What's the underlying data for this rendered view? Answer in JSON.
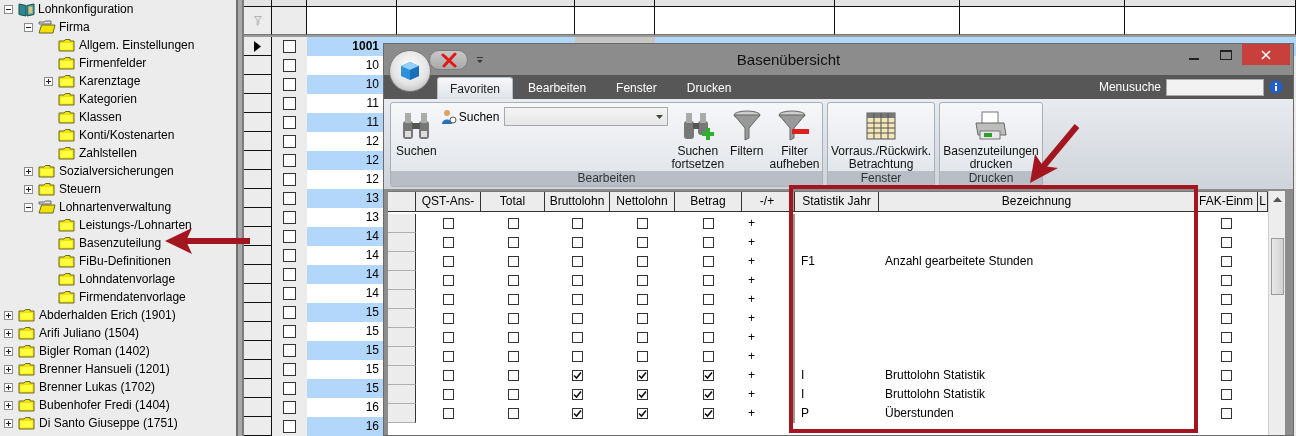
{
  "tree": [
    {
      "label": "Lohnkonfiguration",
      "kind": "root",
      "expanded": true,
      "children": [
        {
          "label": "Firma",
          "kind": "node",
          "expanded": true,
          "children": [
            {
              "label": "Allgem. Einstellungen",
              "kind": "leaf"
            },
            {
              "label": "Firmenfelder",
              "kind": "leaf"
            },
            {
              "label": "Karenztage",
              "kind": "node",
              "expanded": false
            },
            {
              "label": "Kategorien",
              "kind": "leaf"
            },
            {
              "label": "Klassen",
              "kind": "leaf"
            },
            {
              "label": "Konti/Kostenarten",
              "kind": "leaf"
            },
            {
              "label": "Zahlstellen",
              "kind": "leaf"
            }
          ]
        },
        {
          "label": "Sozialversicherungen",
          "kind": "node",
          "expanded": false
        },
        {
          "label": "Steuern",
          "kind": "node",
          "expanded": false
        },
        {
          "label": "Lohnartenverwaltung",
          "kind": "node",
          "expanded": true,
          "children": [
            {
              "label": "Leistungs-/Lohnarten",
              "kind": "leaf"
            },
            {
              "label": "Basenzuteilung",
              "kind": "leaf"
            },
            {
              "label": "FiBu-Definitionen",
              "kind": "leaf"
            },
            {
              "label": "Lohndatenvorlage",
              "kind": "leaf"
            },
            {
              "label": "Firmendatenvorlage",
              "kind": "leaf"
            }
          ]
        }
      ]
    },
    {
      "label": "Abderhalden Erich (1901)",
      "kind": "node",
      "expanded": false
    },
    {
      "label": "Arifi Juliano (1504)",
      "kind": "node",
      "expanded": false
    },
    {
      "label": "Bigler Roman (1402)",
      "kind": "node",
      "expanded": false
    },
    {
      "label": "Brenner Hansueli (1201)",
      "kind": "node",
      "expanded": false
    },
    {
      "label": "Brenner Lukas (1702)",
      "kind": "node",
      "expanded": false
    },
    {
      "label": "Bubenhofer Fredi (1404)",
      "kind": "node",
      "expanded": false
    },
    {
      "label": "Di Santo Giuseppe (1751)",
      "kind": "node",
      "expanded": false
    }
  ],
  "employee_table": {
    "rows": [
      {
        "selected": true,
        "checked": false,
        "cells": [
          "1001"
        ]
      },
      {
        "selected": false,
        "checked": false,
        "cells": [
          "10"
        ]
      },
      {
        "selected": false,
        "checked": false,
        "cells": [
          "10"
        ]
      },
      {
        "selected": false,
        "checked": false,
        "cells": [
          "11"
        ]
      },
      {
        "selected": false,
        "checked": false,
        "cells": [
          "11"
        ]
      },
      {
        "selected": false,
        "checked": false,
        "cells": [
          "12"
        ]
      },
      {
        "selected": false,
        "checked": false,
        "cells": [
          "12"
        ]
      },
      {
        "selected": false,
        "checked": false,
        "cells": [
          "12"
        ]
      },
      {
        "selected": false,
        "checked": false,
        "cells": [
          "13"
        ]
      },
      {
        "selected": false,
        "checked": false,
        "cells": [
          "13"
        ]
      },
      {
        "selected": false,
        "checked": false,
        "cells": [
          "14"
        ]
      },
      {
        "selected": false,
        "checked": false,
        "cells": [
          "14"
        ]
      },
      {
        "selected": false,
        "checked": false,
        "cells": [
          "14"
        ]
      },
      {
        "selected": false,
        "checked": false,
        "cells": [
          "14"
        ]
      },
      {
        "selected": false,
        "checked": false,
        "cells": [
          "15"
        ]
      },
      {
        "selected": false,
        "checked": false,
        "cells": [
          "15"
        ]
      },
      {
        "selected": false,
        "checked": false,
        "cells": [
          "15"
        ]
      },
      {
        "selected": false,
        "checked": false,
        "cells": [
          "15"
        ]
      },
      {
        "selected": false,
        "checked": false,
        "cells": [
          "15"
        ]
      },
      {
        "selected": false,
        "checked": false,
        "cells": [
          "16"
        ]
      },
      {
        "selected": false,
        "checked": false,
        "cells": [
          "16"
        ]
      }
    ]
  },
  "window": {
    "title": "Basenübersicht",
    "ribbon": {
      "tabs": [
        {
          "label": "Favoriten",
          "selected": true
        },
        {
          "label": "Bearbeiten",
          "selected": false
        },
        {
          "label": "Fenster",
          "selected": false
        },
        {
          "label": "Drucken",
          "selected": false
        }
      ],
      "menu_search": {
        "label": "Menusuche"
      },
      "groups": [
        {
          "label": "Bearbeiten",
          "items": [
            {
              "kind": "large",
              "lines": [
                "Suchen"
              ]
            },
            {
              "kind": "search",
              "label": "Suchen"
            },
            {
              "kind": "large",
              "lines": [
                "Suchen",
                "fortsetzen"
              ]
            },
            {
              "kind": "large",
              "lines": [
                "Filtern"
              ]
            },
            {
              "kind": "large",
              "lines": [
                "Filter",
                "aufheben"
              ]
            }
          ]
        },
        {
          "label": "Fenster",
          "items": [
            {
              "kind": "large",
              "lines": [
                "Vorraus./Rückwirk.",
                "Betrachtung"
              ]
            }
          ]
        },
        {
          "label": "Drucken",
          "items": [
            {
              "kind": "large",
              "lines": [
                "Basenzuteilungen",
                "drucken"
              ]
            }
          ]
        }
      ]
    },
    "table": {
      "columns": [
        "QST-Ans-",
        "Total",
        "Bruttolohn",
        "Nettolohn",
        "Betrag",
        "-/+",
        "Statistik Jahr",
        "Bezeichnung",
        "FAK-Einm",
        "L"
      ],
      "rows": [
        {
          "qst": false,
          "total": false,
          "brutto": false,
          "netto": false,
          "betrag": false,
          "sign": "+",
          "fak": false
        },
        {
          "qst": false,
          "total": false,
          "brutto": false,
          "netto": false,
          "betrag": false,
          "sign": "+",
          "fak": false
        },
        {
          "qst": false,
          "total": false,
          "brutto": false,
          "netto": false,
          "betrag": false,
          "sign": "+",
          "statistik": "F1",
          "bezeichnung": "Anzahl gearbeitete Stunden",
          "fak": false
        },
        {
          "qst": false,
          "total": false,
          "brutto": false,
          "netto": false,
          "betrag": false,
          "sign": "+",
          "fak": false
        },
        {
          "qst": false,
          "total": false,
          "brutto": false,
          "netto": false,
          "betrag": false,
          "sign": "+",
          "fak": false
        },
        {
          "qst": false,
          "total": false,
          "brutto": false,
          "netto": false,
          "betrag": false,
          "sign": "+",
          "fak": false
        },
        {
          "qst": false,
          "total": false,
          "brutto": false,
          "netto": false,
          "betrag": false,
          "sign": "+",
          "fak": false
        },
        {
          "qst": false,
          "total": false,
          "brutto": false,
          "netto": false,
          "betrag": false,
          "sign": "+",
          "fak": false
        },
        {
          "qst": false,
          "total": false,
          "brutto": true,
          "netto": true,
          "betrag": true,
          "sign": "+",
          "statistik": "I",
          "bezeichnung": "Bruttolohn Statistik",
          "fak": false
        },
        {
          "qst": false,
          "total": false,
          "brutto": true,
          "netto": true,
          "betrag": true,
          "sign": "+",
          "statistik": "I",
          "bezeichnung": "Bruttolohn Statistik",
          "fak": false
        },
        {
          "qst": false,
          "total": false,
          "brutto": true,
          "netto": true,
          "betrag": true,
          "sign": "+",
          "statistik": "P",
          "bezeichnung": "Überstunden",
          "fak": false
        }
      ]
    }
  }
}
